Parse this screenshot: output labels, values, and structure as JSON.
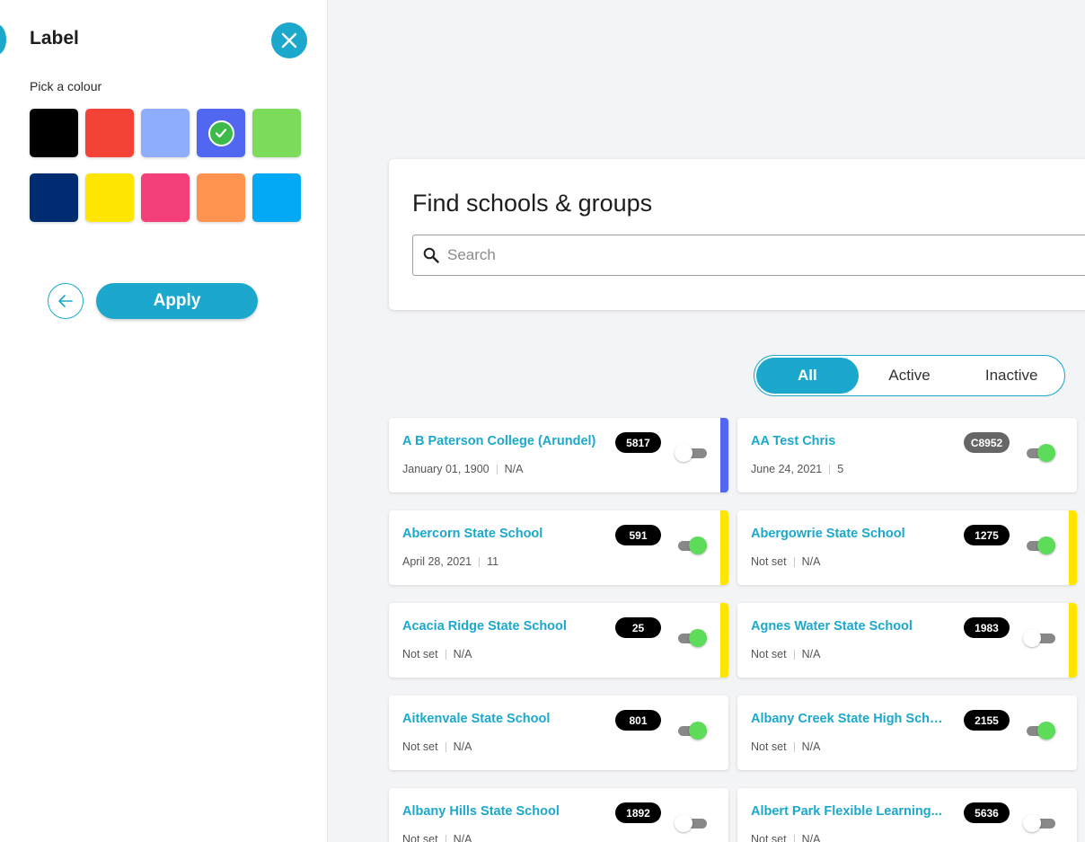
{
  "panel": {
    "title": "Label",
    "pick_label": "Pick a colour",
    "apply_label": "Apply",
    "swatches": [
      {
        "color": "#000000",
        "selected": false
      },
      {
        "color": "#f44336",
        "selected": false
      },
      {
        "color": "#8eadfc",
        "selected": false
      },
      {
        "color": "#5167f0",
        "selected": true
      },
      {
        "color": "#7cdb5a",
        "selected": false
      },
      {
        "color": "#002d72",
        "selected": false
      },
      {
        "color": "#ffe500",
        "selected": false
      },
      {
        "color": "#f43f7a",
        "selected": false
      },
      {
        "color": "#ff9450",
        "selected": false
      },
      {
        "color": "#03a9f4",
        "selected": false
      }
    ]
  },
  "find": {
    "title": "Find schools & groups",
    "search_placeholder": "Search"
  },
  "filter": {
    "tabs": [
      "All",
      "Active",
      "Inactive"
    ],
    "active": "All"
  },
  "colors": {
    "accent": "#1ba8cc",
    "toggle_on": "#5ddc5a"
  },
  "schools": [
    {
      "name": "A B Paterson College (Arundel)",
      "date": "January 01, 1900",
      "extra": "N/A",
      "badge": "5817",
      "badge_style": "black",
      "active": false,
      "label_color": "#5167f0"
    },
    {
      "name": "AA Test Chris",
      "date": "June 24, 2021",
      "extra": "5",
      "badge": "C8952",
      "badge_style": "grey",
      "active": true,
      "label_color": ""
    },
    {
      "name": "Abercorn State School",
      "date": "April 28, 2021",
      "extra": "11",
      "badge": "591",
      "badge_style": "black",
      "active": true,
      "label_color": "#ffe500"
    },
    {
      "name": "Abergowrie State School",
      "date": "Not set",
      "extra": "N/A",
      "badge": "1275",
      "badge_style": "black",
      "active": true,
      "label_color": "#ffe500"
    },
    {
      "name": "Acacia Ridge State School",
      "date": "Not set",
      "extra": "N/A",
      "badge": "25",
      "badge_style": "black",
      "active": true,
      "label_color": "#ffe500"
    },
    {
      "name": "Agnes Water State School",
      "date": "Not set",
      "extra": "N/A",
      "badge": "1983",
      "badge_style": "black",
      "active": false,
      "label_color": "#ffe500"
    },
    {
      "name": "Aitkenvale State School",
      "date": "Not set",
      "extra": "N/A",
      "badge": "801",
      "badge_style": "black",
      "active": true,
      "label_color": ""
    },
    {
      "name": "Albany Creek State High School",
      "date": "Not set",
      "extra": "N/A",
      "badge": "2155",
      "badge_style": "black",
      "active": true,
      "label_color": ""
    },
    {
      "name": "Albany Hills State School",
      "date": "Not set",
      "extra": "N/A",
      "badge": "1892",
      "badge_style": "black",
      "active": false,
      "label_color": ""
    },
    {
      "name": "Albert Park Flexible Learning...",
      "date": "Not set",
      "extra": "N/A",
      "badge": "5636",
      "badge_style": "black",
      "active": false,
      "label_color": ""
    }
  ]
}
